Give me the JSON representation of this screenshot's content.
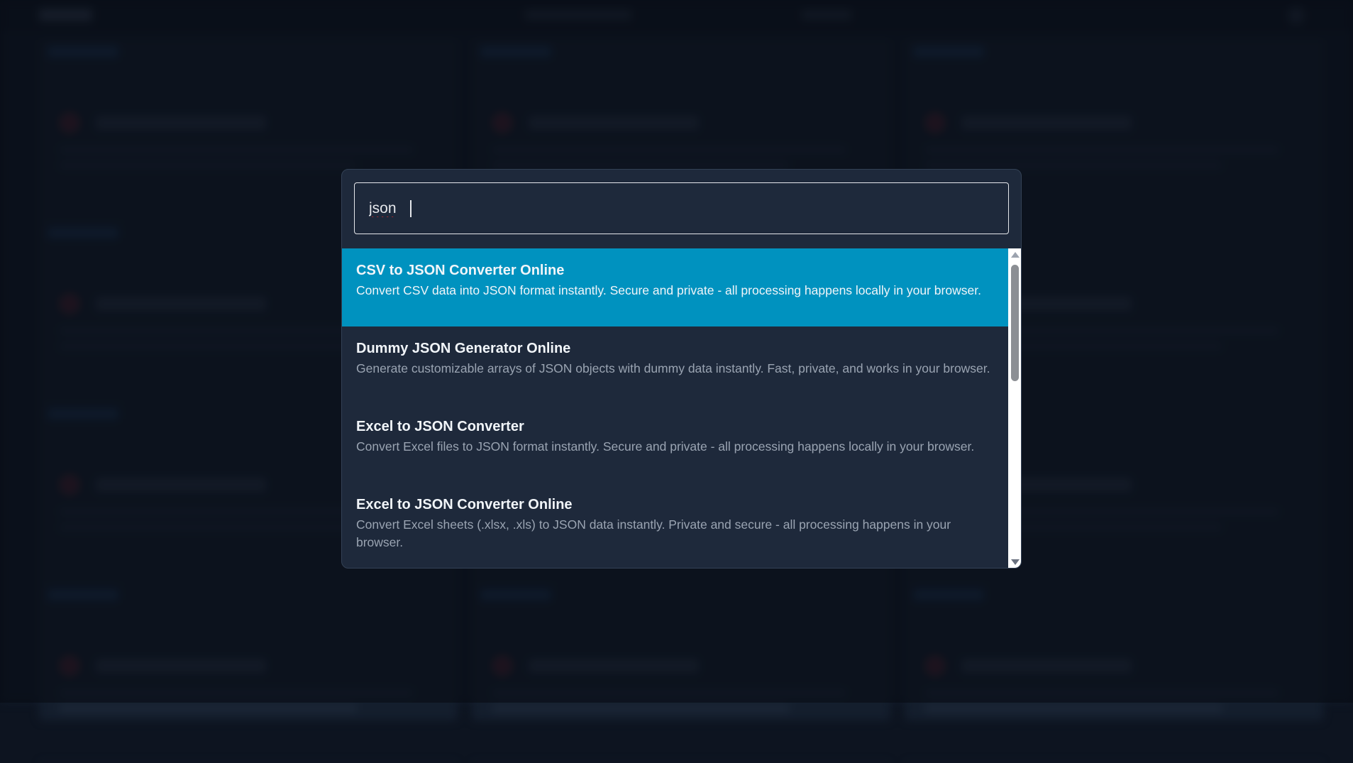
{
  "search": {
    "value": "json"
  },
  "results": [
    {
      "title": "CSV to JSON Converter Online",
      "description": "Convert CSV data into JSON format instantly. Secure and private - all processing happens locally in your browser.",
      "active": true
    },
    {
      "title": "Dummy JSON Generator Online",
      "description": "Generate customizable arrays of JSON objects with dummy data instantly. Fast, private, and works in your browser.",
      "active": false
    },
    {
      "title": "Excel to JSON Converter",
      "description": "Convert Excel files to JSON format instantly. Secure and private - all processing happens locally in your browser.",
      "active": false
    },
    {
      "title": "Excel to JSON Converter Online",
      "description": "Convert Excel sheets (.xlsx, .xls) to JSON data instantly. Private and secure - all processing happens in your browser.",
      "active": false
    }
  ],
  "colors": {
    "active_item": "#0092bf",
    "modal_bg": "#1e293b",
    "backdrop": "#0d1420"
  }
}
